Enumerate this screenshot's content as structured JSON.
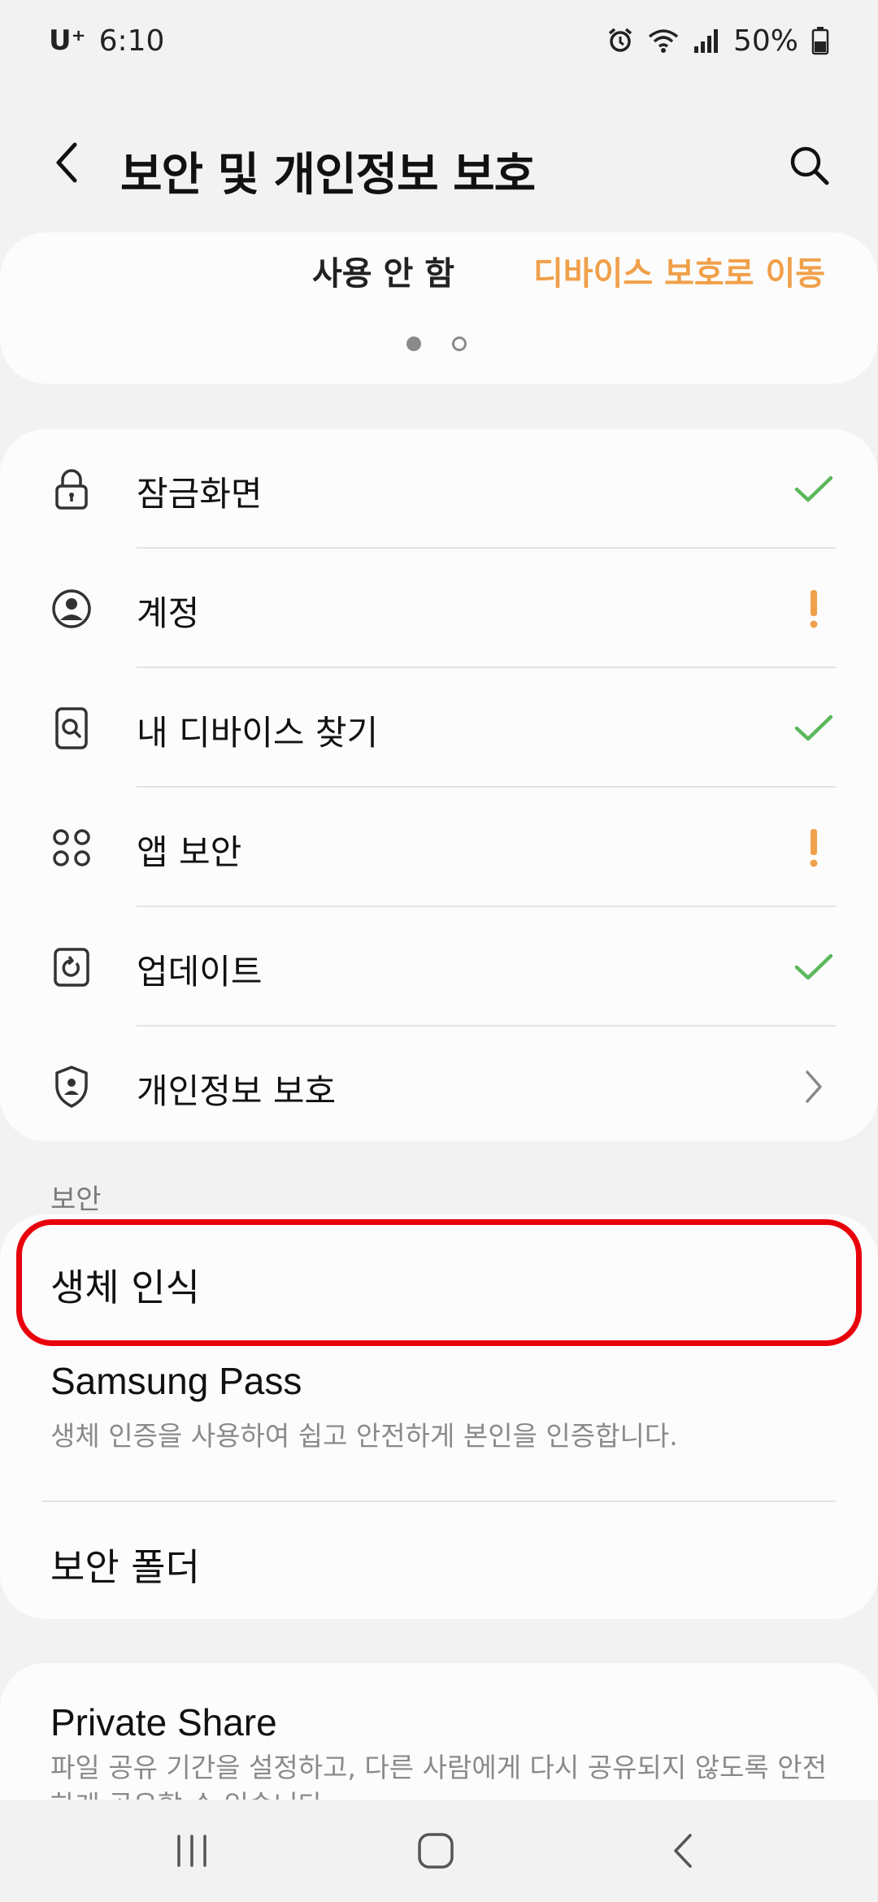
{
  "status_bar": {
    "carrier": "U⁺",
    "time": "6:10",
    "battery": "50%",
    "icons": [
      "alarm-icon",
      "wifi-icon",
      "signal-icon",
      "battery-icon"
    ]
  },
  "header": {
    "title": "보안 및 개인정보 보호",
    "back_icon": "chevron-left-icon",
    "search_icon": "search-icon"
  },
  "top_card": {
    "action_disable": "사용 안 함",
    "action_goto": "디바이스 보호로 이동",
    "pager": {
      "count": 2,
      "active": 0
    }
  },
  "status_list": {
    "items": [
      {
        "label": "잠금화면",
        "icon": "lock-icon",
        "status": "check"
      },
      {
        "label": "계정",
        "icon": "account-icon",
        "status": "warning"
      },
      {
        "label": "내 디바이스 찾기",
        "icon": "find-device-icon",
        "status": "check"
      },
      {
        "label": "앱 보안",
        "icon": "apps-icon",
        "status": "warning"
      },
      {
        "label": "업데이트",
        "icon": "update-icon",
        "status": "check"
      },
      {
        "label": "개인정보 보호",
        "icon": "shield-person-icon",
        "status": "chevron"
      }
    ]
  },
  "security_section": {
    "header": "보안",
    "biometrics": "생체 인식",
    "samsung_pass": {
      "title": "Samsung Pass",
      "description": "생체 인증을 사용하여 쉽고 안전하게 본인을 인증합니다."
    },
    "secure_folder": "보안 폴더"
  },
  "private_share": {
    "title": "Private Share",
    "description": "파일 공유 기간을 설정하고, 다른 사람에게 다시 공유되지 않도록 안전하게 공유할 수 있습니다."
  },
  "colors": {
    "accent_orange": "#f0a04a",
    "check_green": "#5cb85c",
    "highlight_red": "#e8000b"
  }
}
